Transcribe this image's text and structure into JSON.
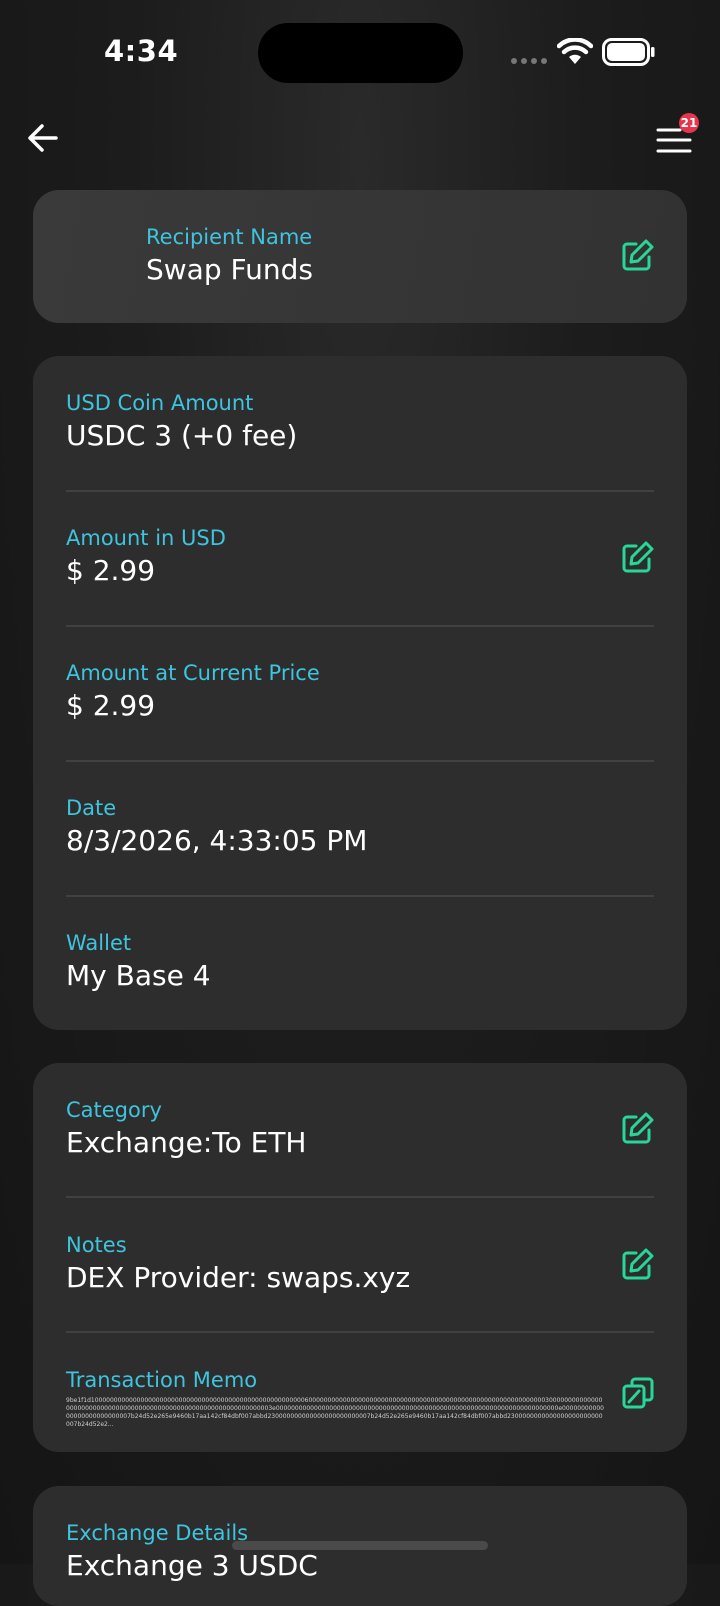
{
  "status_bar": {
    "time": "4:34"
  },
  "nav": {
    "badge_count": "21"
  },
  "recipient": {
    "label": "Recipient Name",
    "value": "Swap Funds"
  },
  "details": {
    "coin_amount": {
      "label": "USD Coin Amount",
      "value": "USDC 3 (+0 fee)"
    },
    "amount_usd": {
      "label": "Amount in USD",
      "value": "$ 2.99"
    },
    "amount_current": {
      "label": "Amount at Current Price",
      "value": "$ 2.99"
    },
    "date": {
      "label": "Date",
      "value": "8/3/2026, 4:33:05 PM"
    },
    "wallet": {
      "label": "Wallet",
      "value": "My Base 4"
    }
  },
  "meta": {
    "category": {
      "label": "Category",
      "value": "Exchange:To ETH"
    },
    "notes": {
      "label": "Notes",
      "value": "DEX Provider: swaps.xyz"
    },
    "memo": {
      "label": "Transaction Memo",
      "value": "9be1f1d10000000000000000000000000000000000000000000000000000000600000000000000000000000000000000000000000000000000000000000000300000000000000000000000000000000000000000000000000000000000000000003e00000000000000000000000000000000000000000000000000000000000000000000000000e0000000000000000000000000007b24d52e265e9460b17aa142cf84dbf007abbd230000000000000000000000007b24d52e265e9460b17aa142cf84dbf007abbd2300000000000000000000000007b24d52e2..."
    }
  },
  "exchange": {
    "label": "Exchange Details",
    "value": "Exchange 3 USDC"
  },
  "colors": {
    "accent": "#3ec4de",
    "edit_icon": "#27d79a",
    "badge": "#e5364b"
  }
}
